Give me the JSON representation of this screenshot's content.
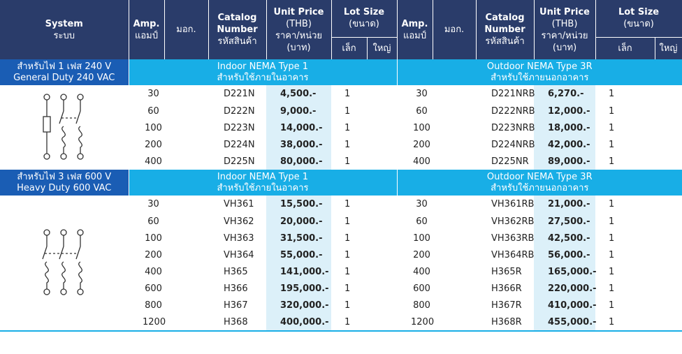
{
  "header": {
    "system": [
      "System",
      "ระบบ"
    ],
    "amp": [
      "Amp.",
      "แอมป์"
    ],
    "mok": "มอก.",
    "catalog": [
      "Catalog",
      "Number",
      "รหัสสินค้า"
    ],
    "unit_price": [
      "Unit Price",
      "(THB)",
      "ราคา/หน่วย",
      "(บาท)"
    ],
    "lot_size": [
      "Lot Size",
      "(ขนาด)"
    ],
    "lot_small": "เล็ก",
    "lot_large": "ใหญ่"
  },
  "sections": [
    {
      "label": [
        "สำหรับไฟ 1 เฟส 240 V",
        "General Duty 240 VAC"
      ],
      "indoor": [
        "Indoor NEMA Type 1",
        "สำหรับใช้ภายในอาคาร"
      ],
      "outdoor": [
        "Outdoor NEMA Type 3R",
        "สำหรับใช้ภายนอกอาคาร"
      ],
      "diagram_icon": "fused-switch-schematic-icon",
      "rows": [
        {
          "amp": "30",
          "cat": "D221N",
          "price": "4,500.-",
          "lot": "1",
          "amp2": "30",
          "cat2": "D221NRB",
          "price2": "6,270.-",
          "lot2": "1"
        },
        {
          "amp": "60",
          "cat": "D222N",
          "price": "9,000.-",
          "lot": "1",
          "amp2": "60",
          "cat2": "D222NRB",
          "price2": "12,000.-",
          "lot2": "1"
        },
        {
          "amp": "100",
          "cat": "D223N",
          "price": "14,000.-",
          "lot": "1",
          "amp2": "100",
          "cat2": "D223NRB",
          "price2": "18,000.-",
          "lot2": "1"
        },
        {
          "amp": "200",
          "cat": "D224N",
          "price": "38,000.-",
          "lot": "1",
          "amp2": "200",
          "cat2": "D224NRB",
          "price2": "42,000.-",
          "lot2": "1"
        },
        {
          "amp": "400",
          "cat": "D225N",
          "price": "80,000.-",
          "lot": "1",
          "amp2": "400",
          "cat2": "D225NR",
          "price2": "89,000.-",
          "lot2": "1"
        }
      ]
    },
    {
      "label": [
        "สำหรับไฟ 3 เฟส 600 V",
        "Heavy Duty 600 VAC"
      ],
      "indoor": [
        "Indoor NEMA Type 1",
        "สำหรับใช้ภายในอาคาร"
      ],
      "outdoor": [
        "Outdoor NEMA Type 3R",
        "สำหรับใช้ภายนอกอาคาร"
      ],
      "diagram_icon": "three-pole-fused-switch-schematic-icon",
      "rows": [
        {
          "amp": "30",
          "cat": "VH361",
          "price": "15,500.-",
          "lot": "1",
          "amp2": "30",
          "cat2": "VH361RB",
          "price2": "21,000.-",
          "lot2": "1"
        },
        {
          "amp": "60",
          "cat": "VH362",
          "price": "20,000.-",
          "lot": "1",
          "amp2": "60",
          "cat2": "VH362RB",
          "price2": "27,500.-",
          "lot2": "1"
        },
        {
          "amp": "100",
          "cat": "VH363",
          "price": "31,500.-",
          "lot": "1",
          "amp2": "100",
          "cat2": "VH363RB",
          "price2": "42,500.-",
          "lot2": "1"
        },
        {
          "amp": "200",
          "cat": "VH364",
          "price": "55,000.-",
          "lot": "1",
          "amp2": "200",
          "cat2": "VH364RB",
          "price2": "56,000.-",
          "lot2": "1"
        },
        {
          "amp": "400",
          "cat": "H365",
          "price": "141,000.-",
          "lot": "1",
          "amp2": "400",
          "cat2": "H365R",
          "price2": "165,000.-",
          "lot2": "1"
        },
        {
          "amp": "600",
          "cat": "H366",
          "price": "195,000.-",
          "lot": "1",
          "amp2": "600",
          "cat2": "H366R",
          "price2": "220,000.-",
          "lot2": "1"
        },
        {
          "amp": "800",
          "cat": "H367",
          "price": "320,000.-",
          "lot": "1",
          "amp2": "800",
          "cat2": "H367R",
          "price2": "410,000.-",
          "lot2": "1"
        },
        {
          "amp": "1200",
          "cat": "H368",
          "price": "400,000.-",
          "lot": "1",
          "amp2": "1200",
          "cat2": "H368R",
          "price2": "455,000.-",
          "lot2": "1"
        }
      ]
    }
  ],
  "colors": {
    "header_bg": "#2a3c6a",
    "section_label_bg": "#1a5db4",
    "section_band_bg": "#18aee6",
    "price_bg": "#dcf0f9"
  }
}
